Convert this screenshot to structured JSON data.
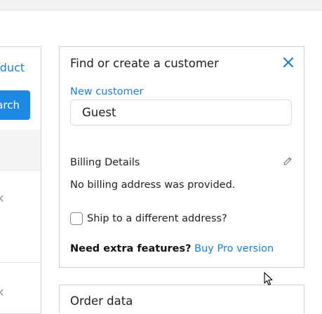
{
  "left_panel": {
    "product_link": "oduct",
    "search_button": "arch",
    "remove_glyph": "✕"
  },
  "customer_card": {
    "title": "Find or create a customer",
    "new_customer_link": "New customer",
    "customer_value": "Guest",
    "billing_title": "Billing Details",
    "billing_text": "No billing address was provided.",
    "ship_label": "Ship to a different address?",
    "ship_checked": false,
    "promo_bold": "Need extra features?",
    "promo_link": "Buy Pro version"
  },
  "next_card": {
    "title": "Order data"
  },
  "colors": {
    "accent": "#1e7fd8",
    "button": "#1e88e5",
    "border": "#cfcfcf"
  }
}
